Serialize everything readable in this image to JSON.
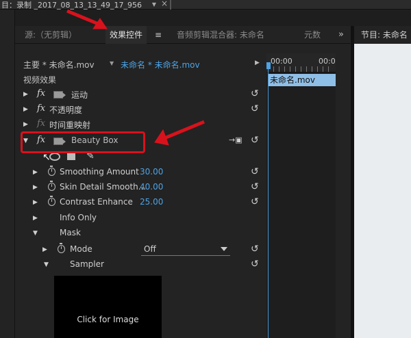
{
  "titlebar": {
    "title": "目：录制 _2017_08_13_13_49_17_956",
    "dropdown": "▼",
    "close": "×"
  },
  "tabs": [
    {
      "label": "源:（无剪辑）"
    },
    {
      "label": "效果控件"
    },
    {
      "label": "音频剪辑混合器: 未命名"
    },
    {
      "label": "元数"
    }
  ],
  "tab_menu": "≡",
  "tab_overflow": "»",
  "program_tab": "节目: 未命名",
  "clipbar": {
    "master": "主要 * 未命名.mov",
    "sequence": "未命名 * 未命名.mov"
  },
  "timeline": {
    "tc_start": "00:00",
    "tc_end": "00:0",
    "clip_name": "未命名.mov"
  },
  "section_title": "视频效果",
  "effects": {
    "motion": "运动",
    "opacity": "不透明度",
    "time_remap": "时间重映射",
    "beauty_box": "Beauty Box"
  },
  "params": {
    "smoothing_label": "Smoothing Amount",
    "smoothing_value": "30.00",
    "skin_label": "Skin Detail Smooth...",
    "skin_value": "40.00",
    "contrast_label": "Contrast Enhance",
    "contrast_value": "25.00",
    "info_only": "Info Only",
    "mask": "Mask",
    "mode_label": "Mode",
    "mode_value": "Off",
    "sampler": "Sampler",
    "click_for_image": "Click for Image"
  },
  "glyphs": {
    "fx": "fx",
    "reset": "↺",
    "expand": "▶",
    "collapse": "▼",
    "mask_icon": "→▣"
  },
  "colors": {
    "accent_blue": "#4da3e6",
    "highlight_red": "#d8121c",
    "clip_blue": "#8fbfe6"
  }
}
